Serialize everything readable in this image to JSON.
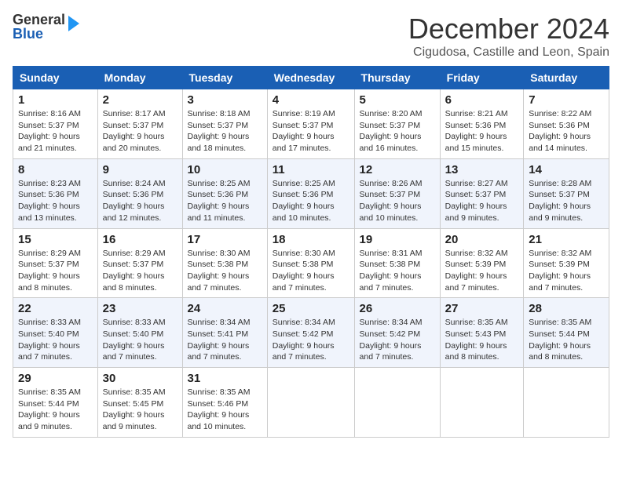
{
  "logo": {
    "general": "General",
    "blue": "Blue"
  },
  "title": "December 2024",
  "location": "Cigudosa, Castille and Leon, Spain",
  "days_of_week": [
    "Sunday",
    "Monday",
    "Tuesday",
    "Wednesday",
    "Thursday",
    "Friday",
    "Saturday"
  ],
  "weeks": [
    [
      {
        "day": "1",
        "sunrise": "8:16 AM",
        "sunset": "5:37 PM",
        "daylight_hours": "9 hours and 21 minutes."
      },
      {
        "day": "2",
        "sunrise": "8:17 AM",
        "sunset": "5:37 PM",
        "daylight_hours": "9 hours and 20 minutes."
      },
      {
        "day": "3",
        "sunrise": "8:18 AM",
        "sunset": "5:37 PM",
        "daylight_hours": "9 hours and 18 minutes."
      },
      {
        "day": "4",
        "sunrise": "8:19 AM",
        "sunset": "5:37 PM",
        "daylight_hours": "9 hours and 17 minutes."
      },
      {
        "day": "5",
        "sunrise": "8:20 AM",
        "sunset": "5:37 PM",
        "daylight_hours": "9 hours and 16 minutes."
      },
      {
        "day": "6",
        "sunrise": "8:21 AM",
        "sunset": "5:36 PM",
        "daylight_hours": "9 hours and 15 minutes."
      },
      {
        "day": "7",
        "sunrise": "8:22 AM",
        "sunset": "5:36 PM",
        "daylight_hours": "9 hours and 14 minutes."
      }
    ],
    [
      {
        "day": "8",
        "sunrise": "8:23 AM",
        "sunset": "5:36 PM",
        "daylight_hours": "9 hours and 13 minutes."
      },
      {
        "day": "9",
        "sunrise": "8:24 AM",
        "sunset": "5:36 PM",
        "daylight_hours": "9 hours and 12 minutes."
      },
      {
        "day": "10",
        "sunrise": "8:25 AM",
        "sunset": "5:36 PM",
        "daylight_hours": "9 hours and 11 minutes."
      },
      {
        "day": "11",
        "sunrise": "8:25 AM",
        "sunset": "5:36 PM",
        "daylight_hours": "9 hours and 10 minutes."
      },
      {
        "day": "12",
        "sunrise": "8:26 AM",
        "sunset": "5:37 PM",
        "daylight_hours": "9 hours and 10 minutes."
      },
      {
        "day": "13",
        "sunrise": "8:27 AM",
        "sunset": "5:37 PM",
        "daylight_hours": "9 hours and 9 minutes."
      },
      {
        "day": "14",
        "sunrise": "8:28 AM",
        "sunset": "5:37 PM",
        "daylight_hours": "9 hours and 9 minutes."
      }
    ],
    [
      {
        "day": "15",
        "sunrise": "8:29 AM",
        "sunset": "5:37 PM",
        "daylight_hours": "9 hours and 8 minutes."
      },
      {
        "day": "16",
        "sunrise": "8:29 AM",
        "sunset": "5:37 PM",
        "daylight_hours": "9 hours and 8 minutes."
      },
      {
        "day": "17",
        "sunrise": "8:30 AM",
        "sunset": "5:38 PM",
        "daylight_hours": "9 hours and 7 minutes."
      },
      {
        "day": "18",
        "sunrise": "8:30 AM",
        "sunset": "5:38 PM",
        "daylight_hours": "9 hours and 7 minutes."
      },
      {
        "day": "19",
        "sunrise": "8:31 AM",
        "sunset": "5:38 PM",
        "daylight_hours": "9 hours and 7 minutes."
      },
      {
        "day": "20",
        "sunrise": "8:32 AM",
        "sunset": "5:39 PM",
        "daylight_hours": "9 hours and 7 minutes."
      },
      {
        "day": "21",
        "sunrise": "8:32 AM",
        "sunset": "5:39 PM",
        "daylight_hours": "9 hours and 7 minutes."
      }
    ],
    [
      {
        "day": "22",
        "sunrise": "8:33 AM",
        "sunset": "5:40 PM",
        "daylight_hours": "9 hours and 7 minutes."
      },
      {
        "day": "23",
        "sunrise": "8:33 AM",
        "sunset": "5:40 PM",
        "daylight_hours": "9 hours and 7 minutes."
      },
      {
        "day": "24",
        "sunrise": "8:34 AM",
        "sunset": "5:41 PM",
        "daylight_hours": "9 hours and 7 minutes."
      },
      {
        "day": "25",
        "sunrise": "8:34 AM",
        "sunset": "5:42 PM",
        "daylight_hours": "9 hours and 7 minutes."
      },
      {
        "day": "26",
        "sunrise": "8:34 AM",
        "sunset": "5:42 PM",
        "daylight_hours": "9 hours and 7 minutes."
      },
      {
        "day": "27",
        "sunrise": "8:35 AM",
        "sunset": "5:43 PM",
        "daylight_hours": "9 hours and 8 minutes."
      },
      {
        "day": "28",
        "sunrise": "8:35 AM",
        "sunset": "5:44 PM",
        "daylight_hours": "9 hours and 8 minutes."
      }
    ],
    [
      {
        "day": "29",
        "sunrise": "8:35 AM",
        "sunset": "5:44 PM",
        "daylight_hours": "9 hours and 9 minutes."
      },
      {
        "day": "30",
        "sunrise": "8:35 AM",
        "sunset": "5:45 PM",
        "daylight_hours": "9 hours and 9 minutes."
      },
      {
        "day": "31",
        "sunrise": "8:35 AM",
        "sunset": "5:46 PM",
        "daylight_hours": "9 hours and 10 minutes."
      },
      null,
      null,
      null,
      null
    ]
  ]
}
